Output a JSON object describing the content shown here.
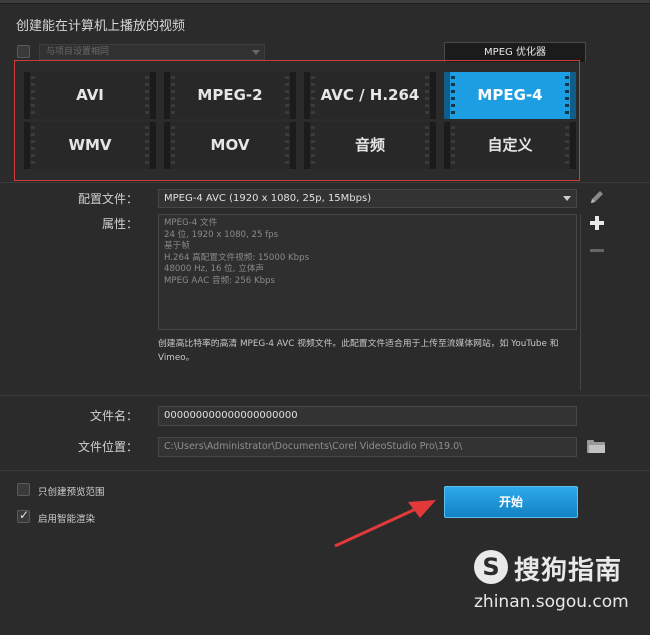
{
  "heading": "创建能在计算机上播放的视频",
  "project_select": {
    "placeholder": "与项目设置相同"
  },
  "mpeg_tab": "MPEG 优化器",
  "formats": [
    {
      "label": "AVI"
    },
    {
      "label": "MPEG-2"
    },
    {
      "label": "AVC / H.264"
    },
    {
      "label": "MPEG-4",
      "active": true
    },
    {
      "label": "WMV"
    },
    {
      "label": "MOV"
    },
    {
      "label": "音频"
    },
    {
      "label": "自定义"
    }
  ],
  "profile": {
    "label": "配置文件：",
    "value": "MPEG-4 AVC (1920 x 1080, 25p, 15Mbps)"
  },
  "properties": {
    "label": "属性：",
    "lines": [
      "MPEG-4 文件",
      "24 位, 1920 x 1080, 25 fps",
      "基于帧",
      "H.264 高配置文件视频: 15000 Kbps",
      "48000 Hz, 16 位, 立体声",
      "MPEG AAC 音频: 256 Kbps"
    ]
  },
  "description": "创建高比特率的高清 MPEG-4 AVC 视频文件。此配置文件适合用于上传至流媒体网站，如 YouTube 和 Vimeo。",
  "file_name": {
    "label": "文件名：",
    "value": "000000000000000000000"
  },
  "file_location": {
    "label": "文件位置：",
    "value": "C:\\Users\\Administrator\\Documents\\Corel VideoStudio Pro\\19.0\\"
  },
  "options": {
    "preview_only": "只创建预览范围",
    "smart_render": "启用智能渲染"
  },
  "start_button": "开始",
  "watermark": {
    "logo": "S",
    "name": "搜狗指南",
    "url": "zhinan.sogou.com"
  },
  "icons": {
    "edit": "pencil-icon",
    "add": "plus-icon",
    "remove": "minus-icon",
    "browse": "folder-icon"
  },
  "colors": {
    "accent": "#1e9ee2",
    "highlight_border": "#d23a3a",
    "arrow": "#e23a3a"
  }
}
